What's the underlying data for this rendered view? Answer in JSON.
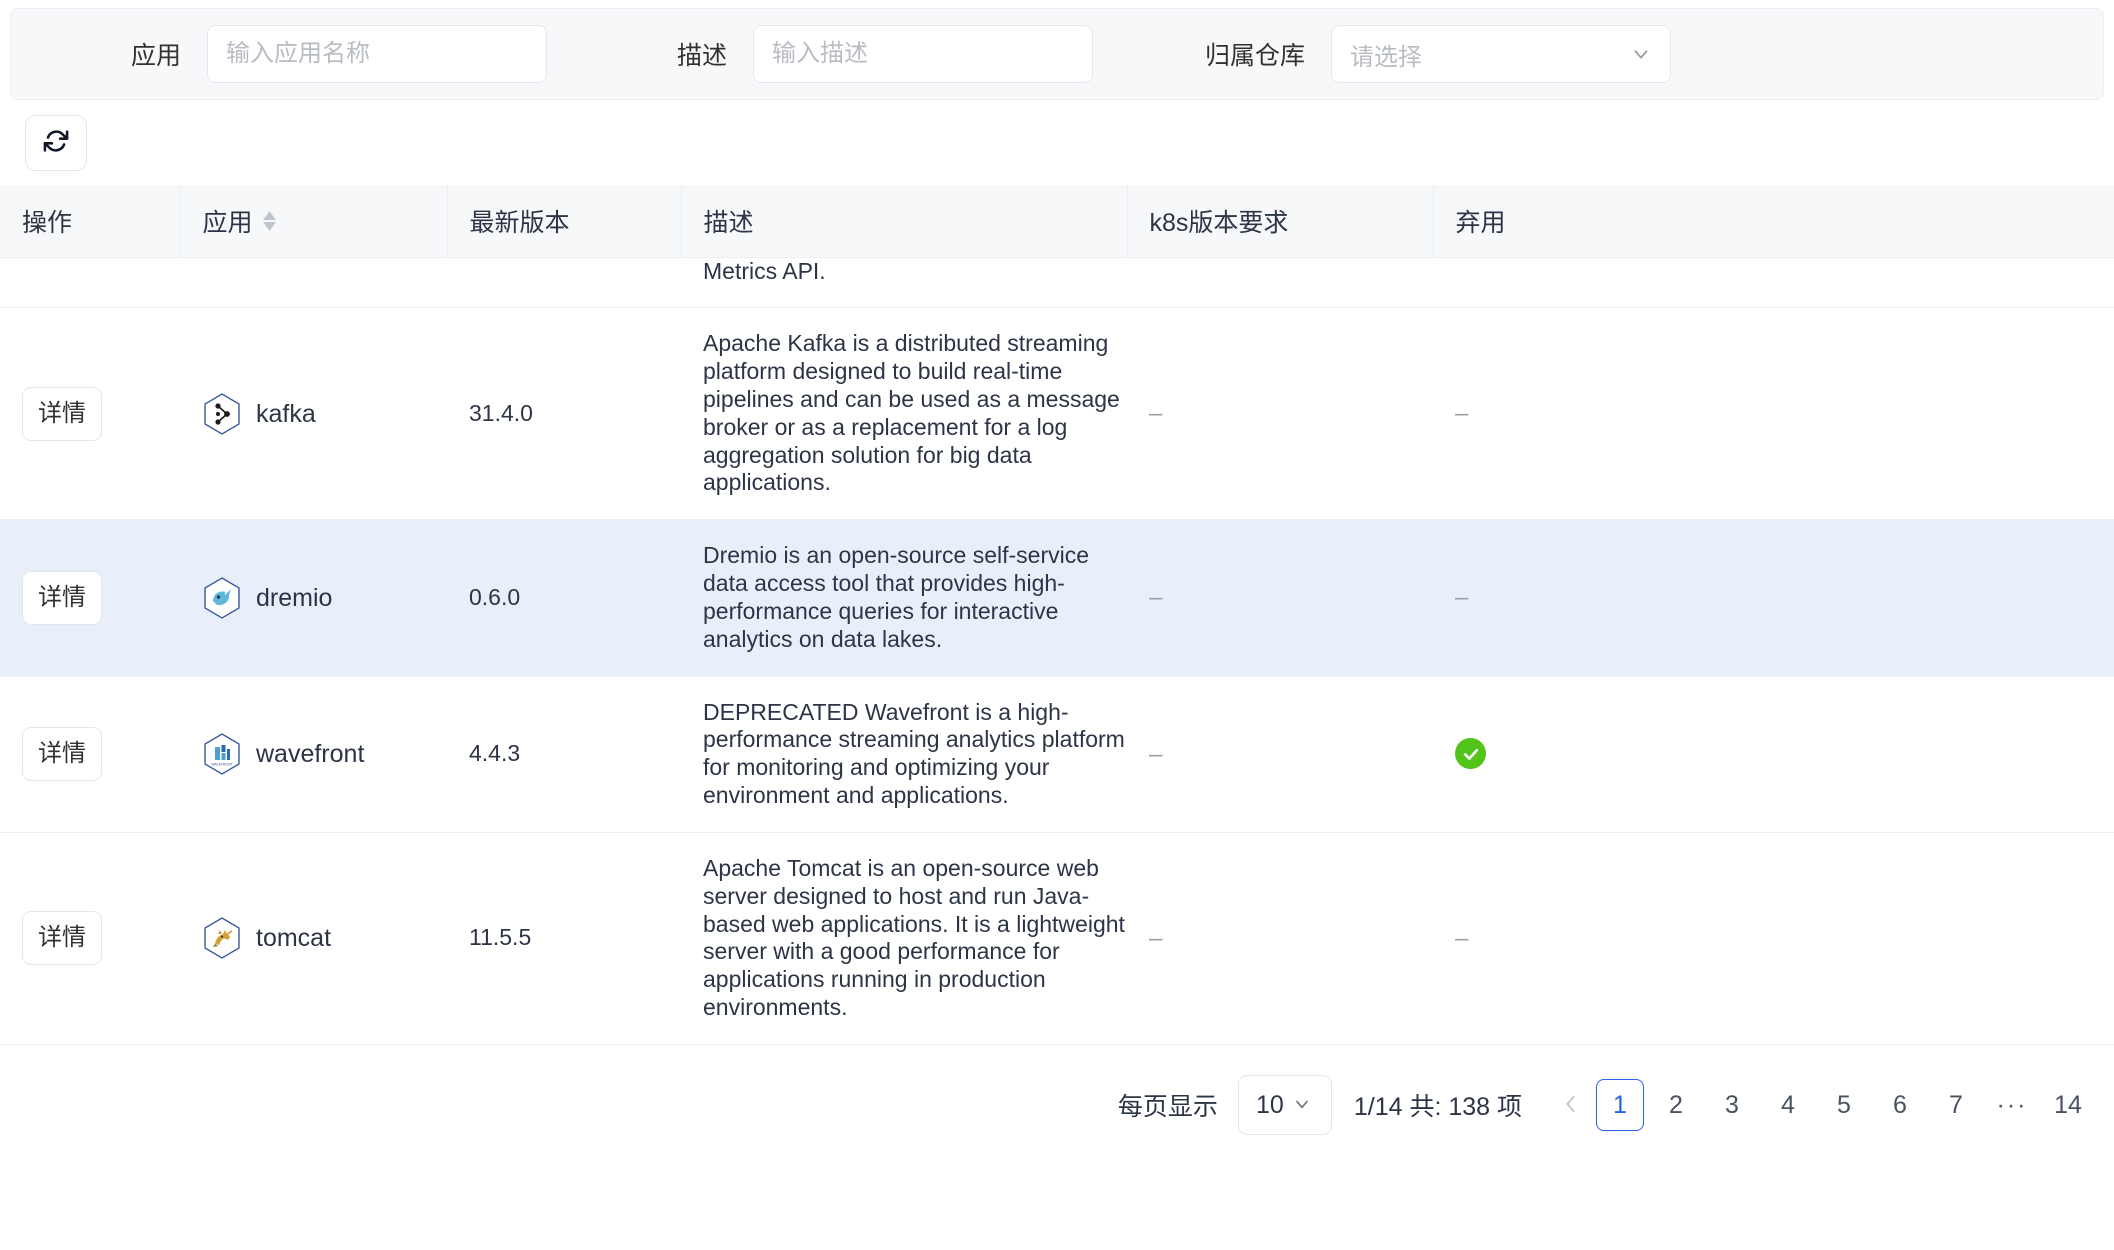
{
  "filter_bar": {
    "app": {
      "label": "应用",
      "placeholder": "输入应用名称",
      "value": ""
    },
    "description": {
      "label": "描述",
      "placeholder": "输入描述",
      "value": ""
    },
    "repository": {
      "label": "归属仓库",
      "placeholder": "请选择",
      "value": ""
    }
  },
  "toolbar": {
    "refresh_icon": "refresh-icon"
  },
  "table": {
    "columns": [
      {
        "key": "action",
        "label": "操作",
        "sortable": false
      },
      {
        "key": "app",
        "label": "应用",
        "sortable": true
      },
      {
        "key": "version",
        "label": "最新版本",
        "sortable": false
      },
      {
        "key": "description",
        "label": "描述",
        "sortable": false
      },
      {
        "key": "k8s",
        "label": "k8s版本要求",
        "sortable": false
      },
      {
        "key": "deprecated",
        "label": "弃用",
        "sortable": false
      }
    ],
    "detail_label": "详情",
    "partial_row": {
      "description": "Metrics API."
    },
    "rows": [
      {
        "action": "详情",
        "app": "kafka",
        "icon": "kafka-icon",
        "version": "31.4.0",
        "description": "Apache Kafka is a distributed streaming platform designed to build real-time pipelines and can be used as a message broker or as a replacement for a log aggregation solution for big data applications.",
        "k8s": "–",
        "deprecated": "–",
        "deprecated_flag": false,
        "highlighted": false
      },
      {
        "action": "详情",
        "app": "dremio",
        "icon": "dremio-icon",
        "version": "0.6.0",
        "description": "Dremio is an open-source self-service data access tool that provides high-performance queries for interactive analytics on data lakes.",
        "k8s": "–",
        "deprecated": "–",
        "deprecated_flag": false,
        "highlighted": true
      },
      {
        "action": "详情",
        "app": "wavefront",
        "icon": "wavefront-icon",
        "version": "4.4.3",
        "description": "DEPRECATED Wavefront is a high-performance streaming analytics platform for monitoring and optimizing your environment and applications.",
        "k8s": "–",
        "deprecated": "",
        "deprecated_flag": true,
        "highlighted": false
      },
      {
        "action": "详情",
        "app": "tomcat",
        "icon": "tomcat-icon",
        "version": "11.5.5",
        "description": "Apache Tomcat is an open-source web server designed to host and run Java-based web applications. It is a lightweight server with a good performance for applications running in production environments.",
        "k8s": "–",
        "deprecated": "–",
        "deprecated_flag": false,
        "highlighted": false
      }
    ]
  },
  "pagination": {
    "per_page_label": "每页显示",
    "per_page_value": "10",
    "summary": "1/14 共: 138 项",
    "current_page": 1,
    "total_pages": 14,
    "pages": [
      "1",
      "2",
      "3",
      "4",
      "5",
      "6",
      "7"
    ],
    "ellipsis": "···",
    "last_page": "14",
    "prev_icon": "chevron-left-icon"
  },
  "colors": {
    "accent": "#2563eb",
    "row_highlight": "#e8effb",
    "header_bg": "#f7f8fa",
    "success": "#52c41a"
  }
}
